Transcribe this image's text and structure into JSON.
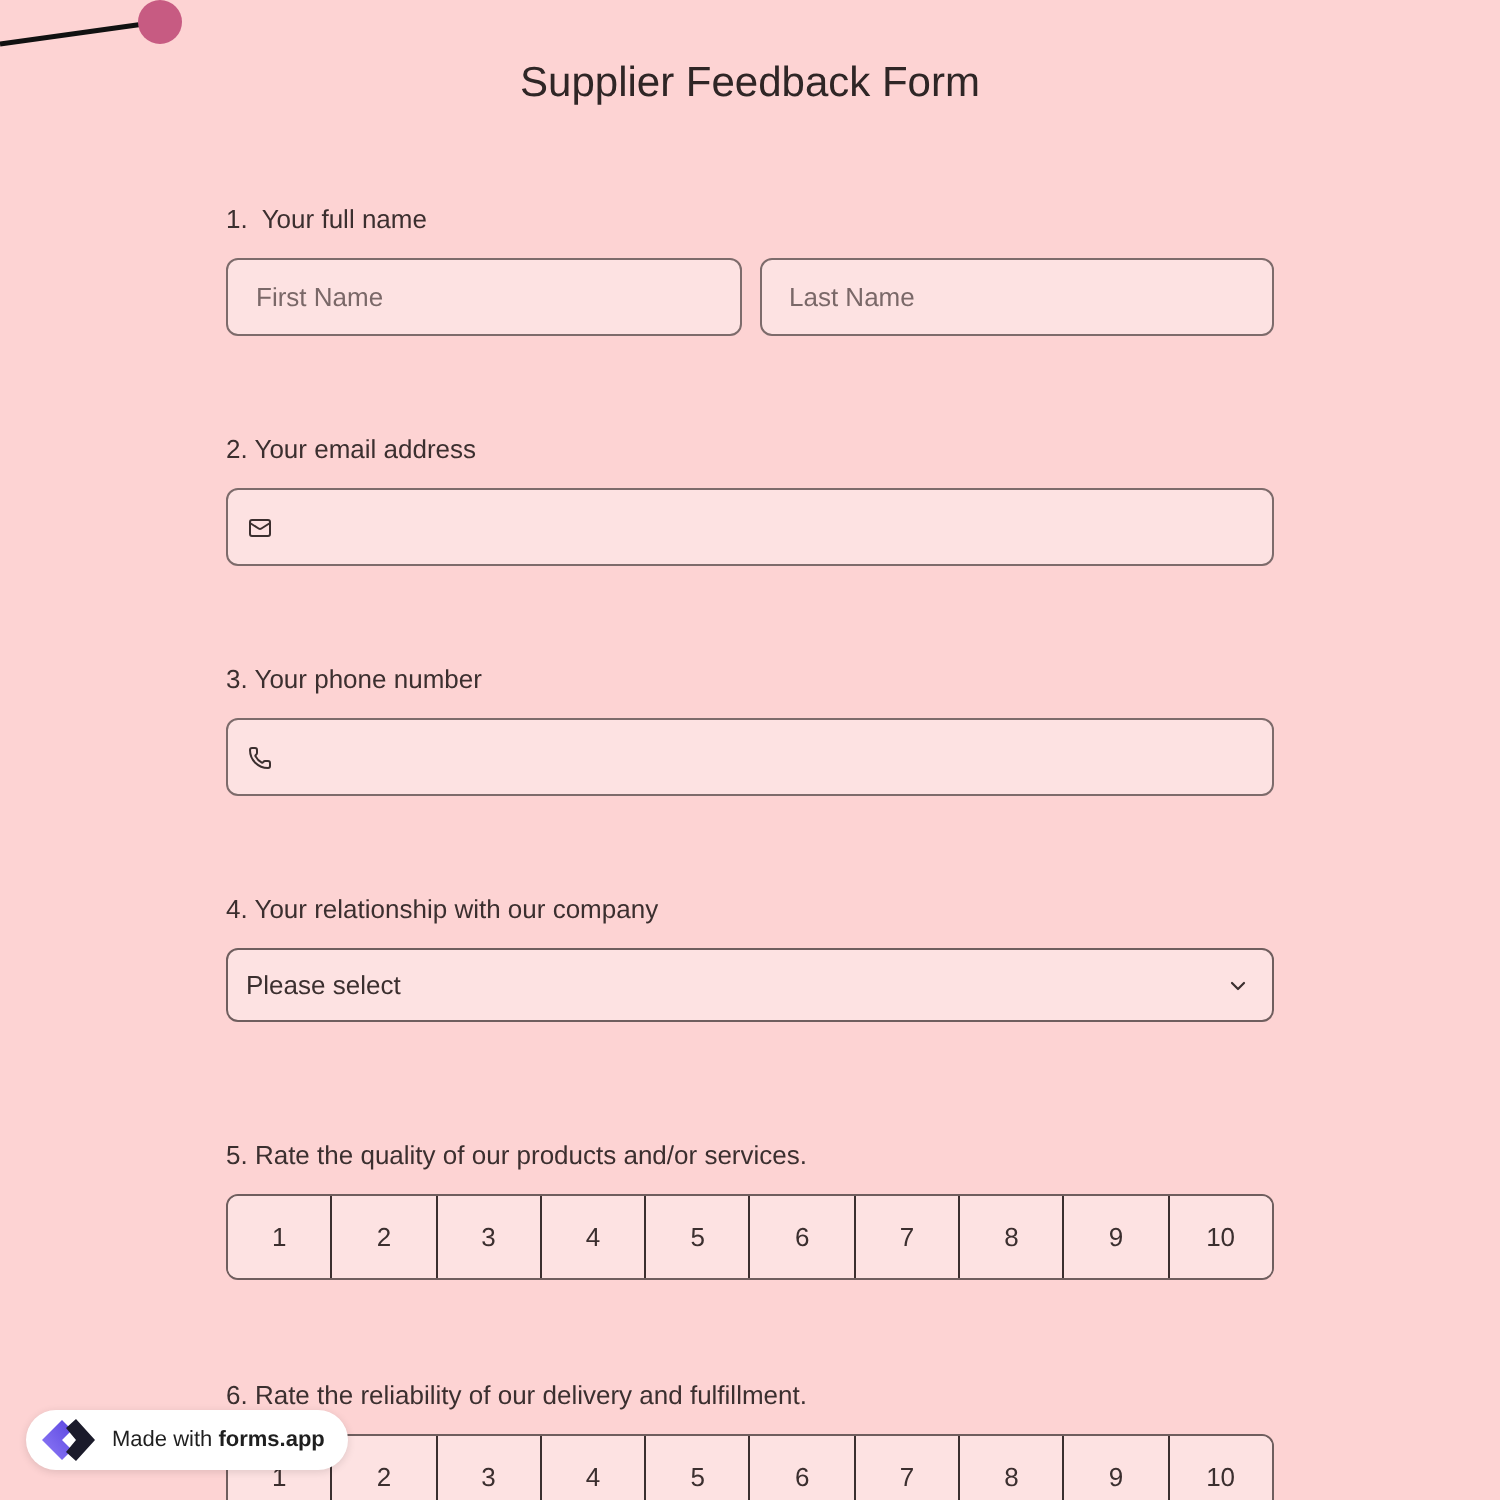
{
  "form": {
    "title": "Supplier Feedback Form"
  },
  "questions": [
    {
      "kind": "name",
      "label": "1.  Your full name",
      "fields": [
        {
          "placeholder": "First Name"
        },
        {
          "placeholder": "Last Name"
        }
      ]
    },
    {
      "kind": "email",
      "label": "2. Your email address"
    },
    {
      "kind": "phone",
      "label": "3. Your phone number"
    },
    {
      "kind": "select",
      "label": "4. Your relationship with our company",
      "placeholder": "Please select"
    },
    {
      "kind": "rating",
      "label": "5. Rate the quality of our products and/or services.",
      "options": [
        {
          "label": "1",
          "selected": false
        },
        {
          "label": "2",
          "selected": false
        },
        {
          "label": "3",
          "selected": false
        },
        {
          "label": "4",
          "selected": false
        },
        {
          "label": "5",
          "selected": false
        },
        {
          "label": "6",
          "selected": false
        },
        {
          "label": "7",
          "selected": false
        },
        {
          "label": "8",
          "selected": false
        },
        {
          "label": "9",
          "selected": false
        },
        {
          "label": "10",
          "selected": false
        }
      ]
    },
    {
      "kind": "rating",
      "label": "6. Rate the reliability of our delivery and fulfillment.",
      "options": [
        {
          "label": "1",
          "selected": false
        },
        {
          "label": "2",
          "selected": false
        },
        {
          "label": "3",
          "selected": false
        },
        {
          "label": "4",
          "selected": false
        },
        {
          "label": "5",
          "selected": false
        },
        {
          "label": "6",
          "selected": false
        },
        {
          "label": "7",
          "selected": false
        },
        {
          "label": "8",
          "selected": false
        },
        {
          "label": "9",
          "selected": false
        },
        {
          "label": "10",
          "selected": false
        }
      ]
    }
  ],
  "badge": {
    "text": "Made with **forms.app**"
  }
}
